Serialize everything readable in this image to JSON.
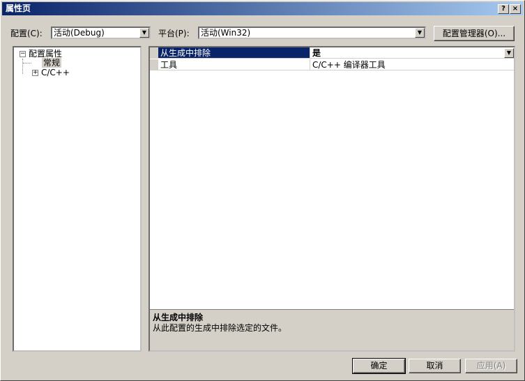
{
  "window": {
    "title": "属性页",
    "help_label": "?",
    "close_label": "×"
  },
  "config": {
    "label": "配置(C):",
    "value": "活动(Debug)"
  },
  "platform": {
    "label": "平台(P):",
    "value": "活动(Win32)"
  },
  "config_manager_label": "配置管理器(O)...",
  "tree": {
    "root_label": "配置属性",
    "root_expander": "−",
    "items": [
      {
        "label": "常规",
        "selected": true
      },
      {
        "label": "C/C++",
        "expander": "+"
      }
    ]
  },
  "grid": {
    "rows": [
      {
        "name": "从生成中排除",
        "value": "是"
      },
      {
        "name": "工具",
        "value": "C/C++ 编译器工具"
      }
    ]
  },
  "description": {
    "title": "从生成中排除",
    "text": "从此配置的生成中排除选定的文件。"
  },
  "buttons": {
    "ok": "确定",
    "cancel": "取消",
    "apply": "应用(A)"
  },
  "colors": {
    "title_start": "#0a246a",
    "title_end": "#a6caf0",
    "face": "#d4d0c8",
    "selection": "#0a246a"
  }
}
